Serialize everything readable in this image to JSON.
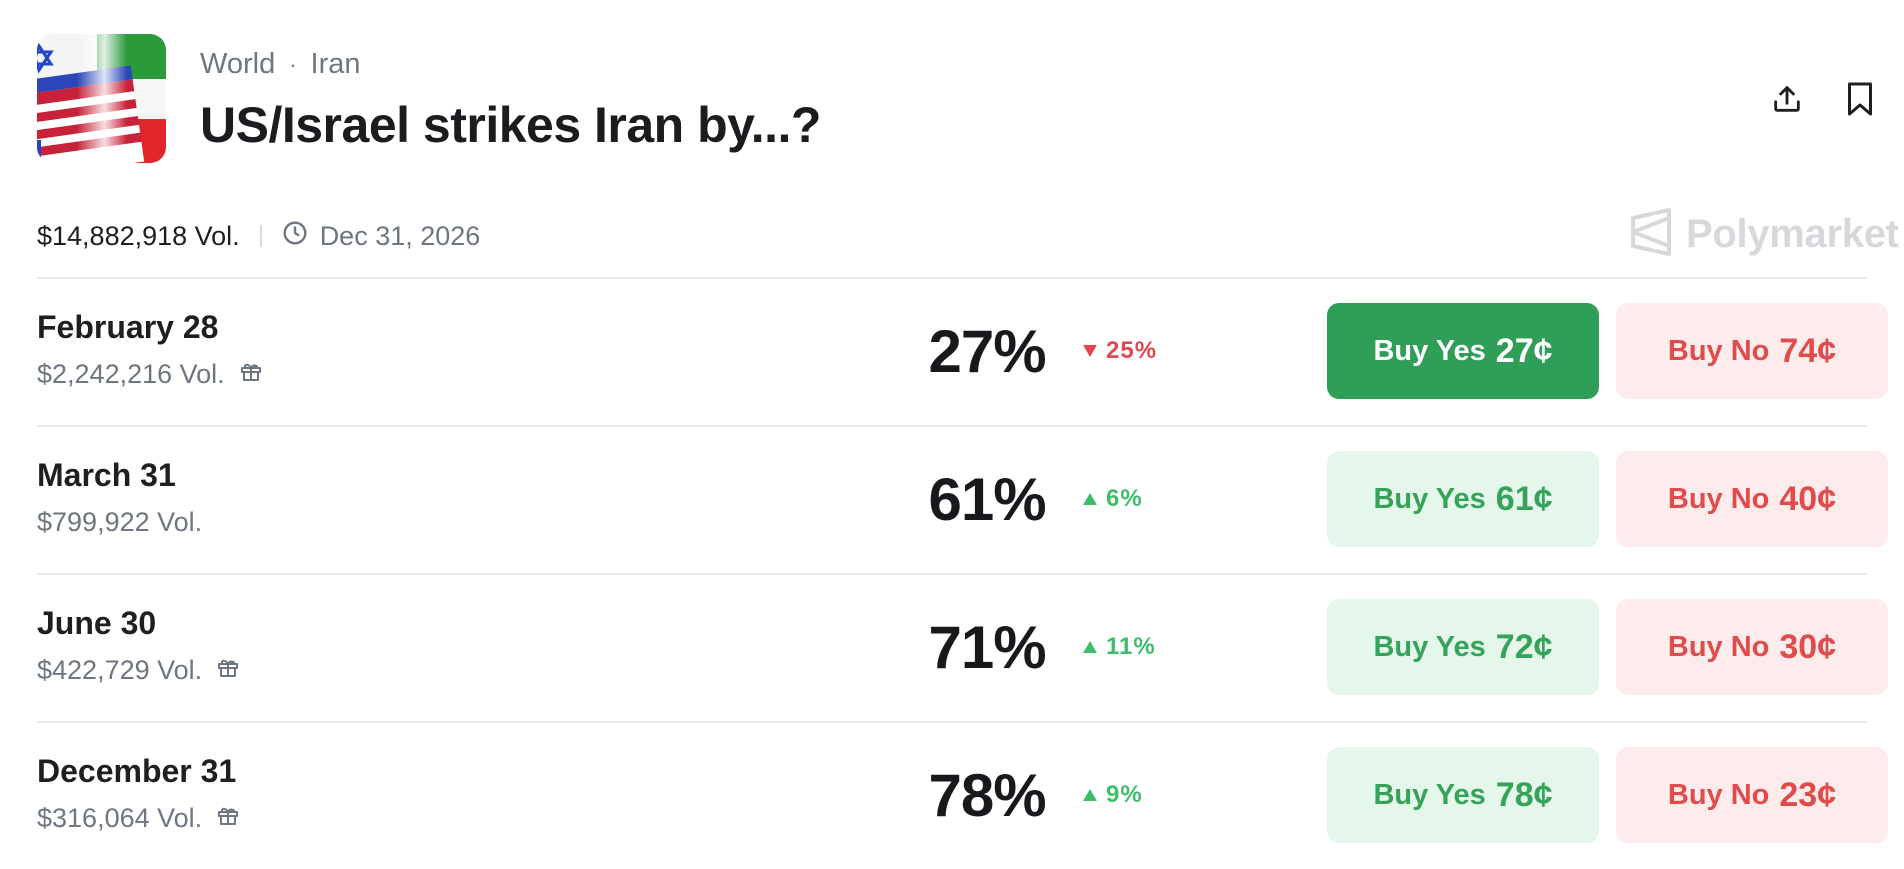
{
  "header": {
    "breadcrumb": [
      "World",
      "Iran"
    ],
    "separator": "·",
    "title": "US/Israel strikes Iran by...?"
  },
  "icons": {
    "share": "upload-icon",
    "bookmark": "bookmark-icon",
    "clock": "clock-icon",
    "gift": "gift-icon",
    "brand_logo": "polymarket-logo-icon"
  },
  "meta": {
    "volume": "$14,882,918 Vol.",
    "end_date": "Dec 31, 2026"
  },
  "brand": {
    "name": "Polymarket"
  },
  "colors": {
    "yes_active": "#2f9e57",
    "yes_soft": "#e4f7ea",
    "no_soft": "#fdeceb",
    "up": "#3fbd6a",
    "down": "#e2474f"
  },
  "outcomes": [
    {
      "date": "February 28",
      "volume": "$2,242,216 Vol.",
      "has_gift": true,
      "probability": "27%",
      "change": "25%",
      "direction": "down",
      "yes_label": "Buy Yes",
      "yes_price": "27¢",
      "no_label": "Buy No",
      "no_price": "74¢",
      "yes_active": true
    },
    {
      "date": "March 31",
      "volume": "$799,922 Vol.",
      "has_gift": false,
      "probability": "61%",
      "change": "6%",
      "direction": "up",
      "yes_label": "Buy Yes",
      "yes_price": "61¢",
      "no_label": "Buy No",
      "no_price": "40¢",
      "yes_active": false
    },
    {
      "date": "June 30",
      "volume": "$422,729 Vol.",
      "has_gift": true,
      "probability": "71%",
      "change": "11%",
      "direction": "up",
      "yes_label": "Buy Yes",
      "yes_price": "72¢",
      "no_label": "Buy No",
      "no_price": "30¢",
      "yes_active": false
    },
    {
      "date": "December 31",
      "volume": "$316,064 Vol.",
      "has_gift": true,
      "probability": "78%",
      "change": "9%",
      "direction": "up",
      "yes_label": "Buy Yes",
      "yes_price": "78¢",
      "no_label": "Buy No",
      "no_price": "23¢",
      "yes_active": false
    }
  ]
}
